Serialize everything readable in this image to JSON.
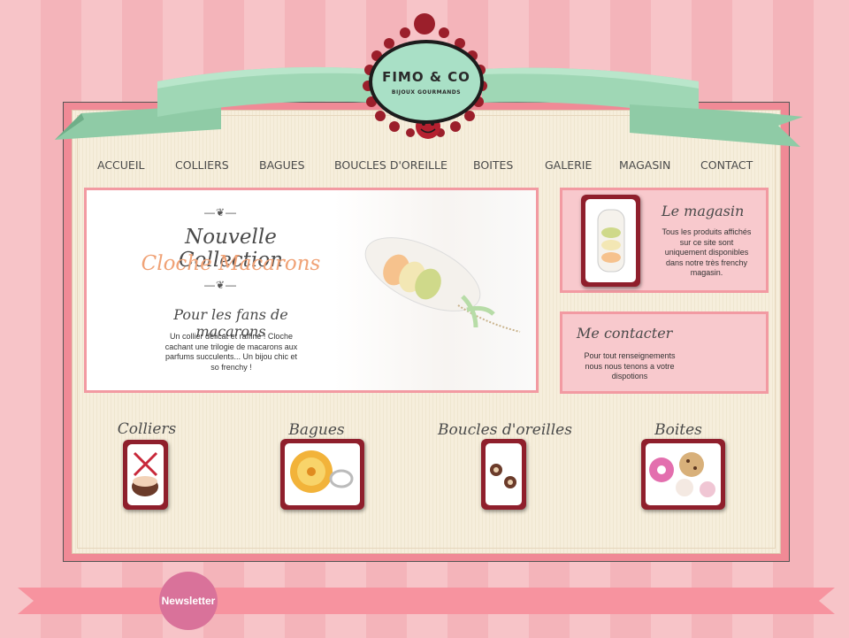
{
  "logo": {
    "title": "FIMO & CO",
    "subtitle": "BIJOUX GOURMANDS"
  },
  "nav": [
    {
      "label": "ACCUEIL"
    },
    {
      "label": "COLLIERS"
    },
    {
      "label": "BAGUES"
    },
    {
      "label": "BOUCLES D'OREILLE"
    },
    {
      "label": "BOITES"
    },
    {
      "label": "GALERIE"
    },
    {
      "label": "MAGASIN"
    },
    {
      "label": "CONTACT"
    }
  ],
  "banner": {
    "title_line1": "Nouvelle Collection",
    "title_line2": "Cloche Macarons",
    "subtitle": "Pour les fans de macarons",
    "description": "Un collier délicat et raffiné ! Cloche cachant une trilogie de macarons aux parfums succulents... Un bijou chic et so frenchy !"
  },
  "magasin": {
    "title": "Le magasin",
    "text": "Tous les produits affichés sur ce site sont uniquement disponibles dans notre très frenchy magasin."
  },
  "contact": {
    "title": "Me contacter",
    "text": "Pour tout renseignements nous nous tenons a votre dispotions"
  },
  "categories": [
    {
      "title": "Colliers"
    },
    {
      "title": "Bagues"
    },
    {
      "title": "Boucles d'oreilles"
    },
    {
      "title": "Boites"
    }
  ],
  "newsletter": {
    "label": "Newsletter"
  },
  "colors": {
    "accent_pink": "#f29aa2",
    "frame_red": "#8f1f2c",
    "mint": "#a9e0c6",
    "newsletter": "#d9729a"
  }
}
